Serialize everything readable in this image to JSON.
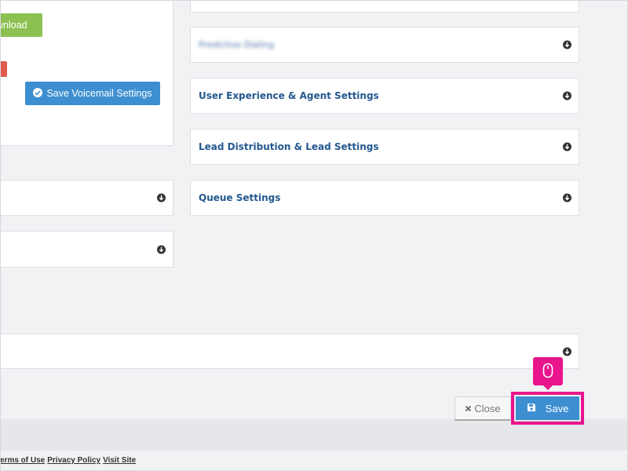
{
  "left_panel": {
    "download_label": "wnload",
    "voicemail_button_label": "Save Voicemail Settings"
  },
  "right_panels": [
    {
      "title": "Predictive Dialing (blurred)",
      "blurred": true
    },
    {
      "title": "User Experience & Agent Settings"
    },
    {
      "title": "Lead Distribution & Lead Settings"
    },
    {
      "title": "Queue Settings"
    }
  ],
  "footer_buttons": {
    "close_label": "Close",
    "save_label": "Save"
  },
  "footer_links": {
    "terms": "erms of Use",
    "privacy": "Privacy Policy",
    "visit": "Visit Site"
  },
  "colors": {
    "accent_blue": "#3d8fd1",
    "title_blue": "#24588f",
    "green": "#8cc152",
    "highlight_pink": "#e8158d"
  },
  "icons": {
    "panel_toggle": "chevron-down-circle-icon",
    "save": "floppy-disk-icon",
    "close": "x-icon",
    "voicemail_save": "check-circle-icon",
    "cursor": "mouse-icon"
  }
}
